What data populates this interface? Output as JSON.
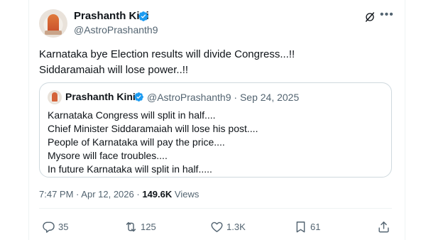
{
  "author": {
    "name": "Prashanth Kini",
    "handle": "@AstroPrashanth9"
  },
  "post": {
    "text": "Karnataka bye Election results will divide Congress...!!\nSiddaramaiah will lose power..!!"
  },
  "quoted_post": {
    "name": "Prashanth Kini",
    "handle": "@AstroPrashanth9",
    "separator": "·",
    "date": "Sep 24, 2025",
    "text": "Karnataka Congress will split in half....\nChief Minister Siddaramaiah will lose his post....\nPeople of Karnataka will pay the price....\nMysore will face troubles....\nIn future Karnataka will split in half....."
  },
  "meta": {
    "time": "7:47 PM",
    "separator": "·",
    "date": "Apr 12, 2026",
    "views_count": "149.6K",
    "views_label": "Views"
  },
  "actions": {
    "replies": "35",
    "reposts": "125",
    "likes": "1.3K",
    "bookmarks": "61"
  },
  "icons": {
    "verified": "verified-badge-icon",
    "grok": "grok-icon",
    "more": "more-icon",
    "reply": "reply-icon",
    "repost": "repost-icon",
    "like": "like-icon",
    "bookmark": "bookmark-icon",
    "share": "share-icon"
  },
  "colors": {
    "verified": "#1d9bf0",
    "text": "#0f1419",
    "secondary": "#536471",
    "border": "#cfd9de"
  }
}
